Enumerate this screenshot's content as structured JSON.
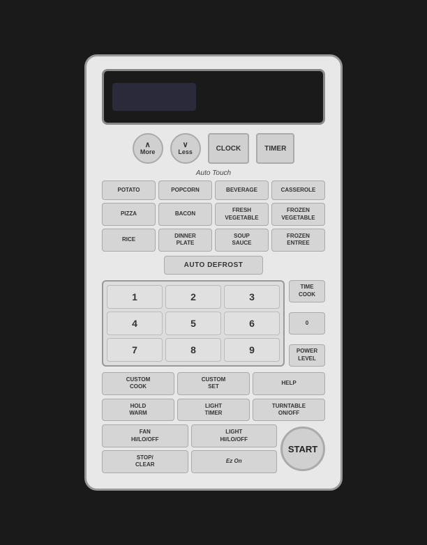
{
  "panel": {
    "top_buttons": {
      "more_label": "More",
      "more_arrow": "∧",
      "less_label": "Less",
      "less_arrow": "∨",
      "clock_label": "CLOCK",
      "timer_label": "TIMER"
    },
    "auto_touch": {
      "section_label": "Auto Touch",
      "buttons": [
        "POTATO",
        "POPCORN",
        "BEVERAGE",
        "CASSEROLE",
        "PIZZA",
        "BACON",
        "FRESH\nVEGETABLE",
        "FROZEN\nVEGETABLE",
        "RICE",
        "DINNER\nPLATE",
        "SOUP\nSAUCE",
        "FROZEN\nENTREE"
      ]
    },
    "auto_defrost": {
      "label": "AUTO DEFROST"
    },
    "numpad": {
      "digits": [
        "1",
        "2",
        "3",
        "4",
        "5",
        "6",
        "7",
        "8",
        "9"
      ],
      "side_buttons": [
        {
          "label": "TIME\nCOOK"
        },
        {
          "label": "0"
        },
        {
          "label": "POWER\nLEVEL"
        }
      ]
    },
    "bottom_buttons_row1": [
      {
        "label": "CUSTOM\nCOOK"
      },
      {
        "label": "CUSTOM\nSET"
      },
      {
        "label": "HELP"
      }
    ],
    "bottom_buttons_row2": [
      {
        "label": "HOLD\nWARM"
      },
      {
        "label": "LIGHT\nTIMER"
      },
      {
        "label": "TURNTABLE\nON/OFF"
      }
    ],
    "last_row_top": [
      {
        "label": "FAN\nHI/LO/OFF"
      },
      {
        "label": "LIGHT\nHI/LO/OFF"
      }
    ],
    "last_row_bottom": [
      {
        "label": "STOP/\nCLEAR"
      },
      {
        "label": "Ez On"
      }
    ],
    "start_label": "START"
  }
}
